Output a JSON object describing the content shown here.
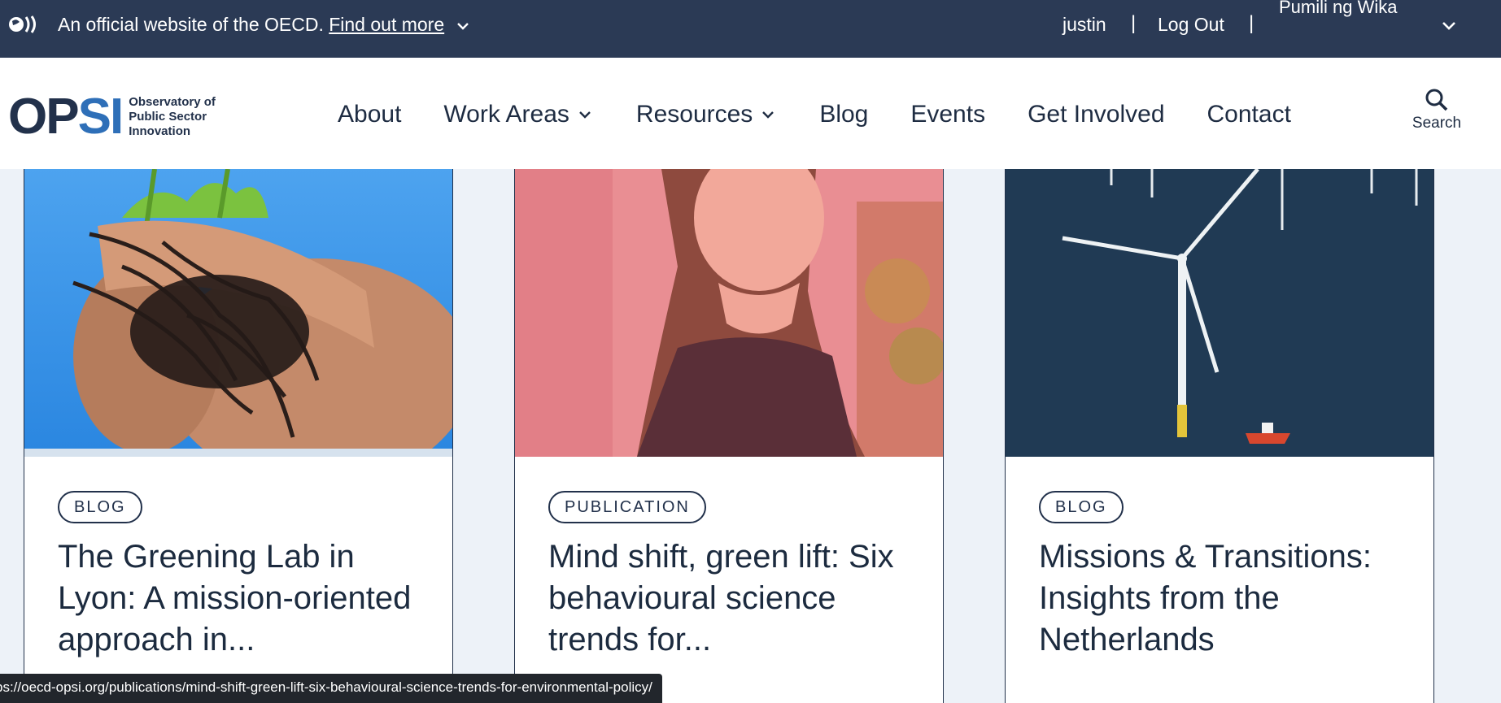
{
  "banner": {
    "official_text": "An official website of the OECD.",
    "find_out_more": "Find out more",
    "user": "justin",
    "separator": "|",
    "logout": "Log Out",
    "language": "Pumili ng Wika"
  },
  "header": {
    "logo_text_line1": "Observatory of",
    "logo_text_line2": "Public Sector",
    "logo_text_line3": "Innovation",
    "logo_mark": "OPSI",
    "nav": [
      {
        "label": "About"
      },
      {
        "label": "Work Areas"
      },
      {
        "label": "Resources"
      },
      {
        "label": "Blog"
      },
      {
        "label": "Events"
      },
      {
        "label": "Get Involved"
      },
      {
        "label": "Contact"
      }
    ],
    "search_label": "Search"
  },
  "cards": [
    {
      "badge": "BLOG",
      "title": "The Greening Lab in Lyon: A mission-oriented approach in..."
    },
    {
      "badge": "PUBLICATION",
      "title": "Mind shift, green lift: Six behavioural science trends for..."
    },
    {
      "badge": "BLOG",
      "title": "Missions & Transitions: Insights from the Netherlands"
    }
  ],
  "status_bar": {
    "url": "ps://oecd-opsi.org/publications/mind-shift-green-lift-six-behavioural-science-trends-for-environmental-policy/"
  },
  "colors": {
    "banner_bg": "#2b3a55",
    "page_bg": "#edf2f8",
    "accent_blue": "#2e6fb8",
    "navy": "#22314b"
  }
}
